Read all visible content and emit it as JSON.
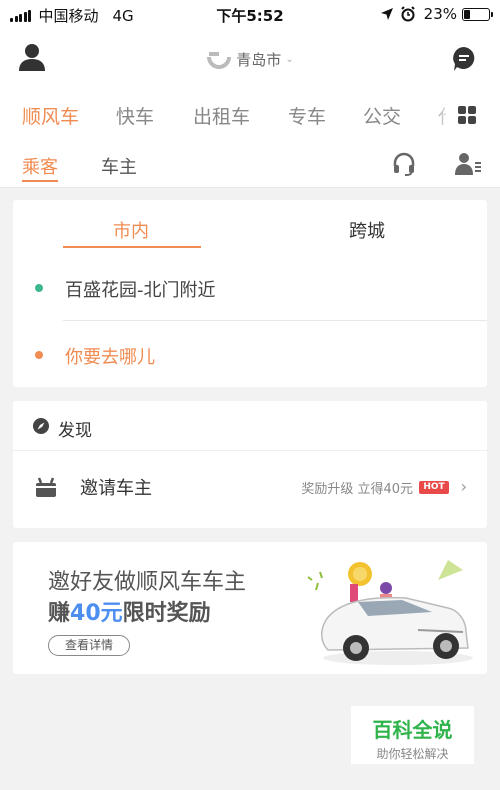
{
  "status_bar": {
    "carrier": "中国移动",
    "network": "4G",
    "time": "下午5:52",
    "battery": "23%",
    "battery_level": 0.23
  },
  "header": {
    "city": "青岛市",
    "icons": [
      "user-icon",
      "didi-logo-icon",
      "chevron-down-icon",
      "message-icon"
    ]
  },
  "services": {
    "tabs": [
      {
        "label": "顺风车",
        "active": true
      },
      {
        "label": "快车"
      },
      {
        "label": "出租车"
      },
      {
        "label": "专车"
      },
      {
        "label": "公交"
      },
      {
        "label": "代"
      }
    ],
    "more_icon": "grid-icon"
  },
  "roles": {
    "tabs": [
      {
        "label": "乘客",
        "active": true
      },
      {
        "label": "车主"
      }
    ],
    "icons": [
      "headset-icon",
      "driver-icon"
    ]
  },
  "route": {
    "tabs": [
      {
        "label": "市内",
        "active": true
      },
      {
        "label": "跨城"
      }
    ],
    "origin": "百盛花园-北门附近",
    "destination_placeholder": "你要去哪儿",
    "colors": {
      "origin": "#3fb78e",
      "destination": "#f08c52"
    }
  },
  "discover": {
    "title": "发现",
    "item_label": "邀请车主",
    "reward": "奖励升级 立得40元",
    "badge": "HOT"
  },
  "banner": {
    "line1": "邀好友做顺风车车主",
    "line2_prefix": "赚",
    "line2_highlight": "40元",
    "line2_suffix": "限时奖励",
    "button": "查看详情"
  },
  "watermark": {
    "title": "百科全说",
    "subtitle": "助你轻松解决"
  },
  "colors": {
    "accent": "#f08c52",
    "highlight": "#4d8ff0",
    "hot": "#e84a4a"
  }
}
